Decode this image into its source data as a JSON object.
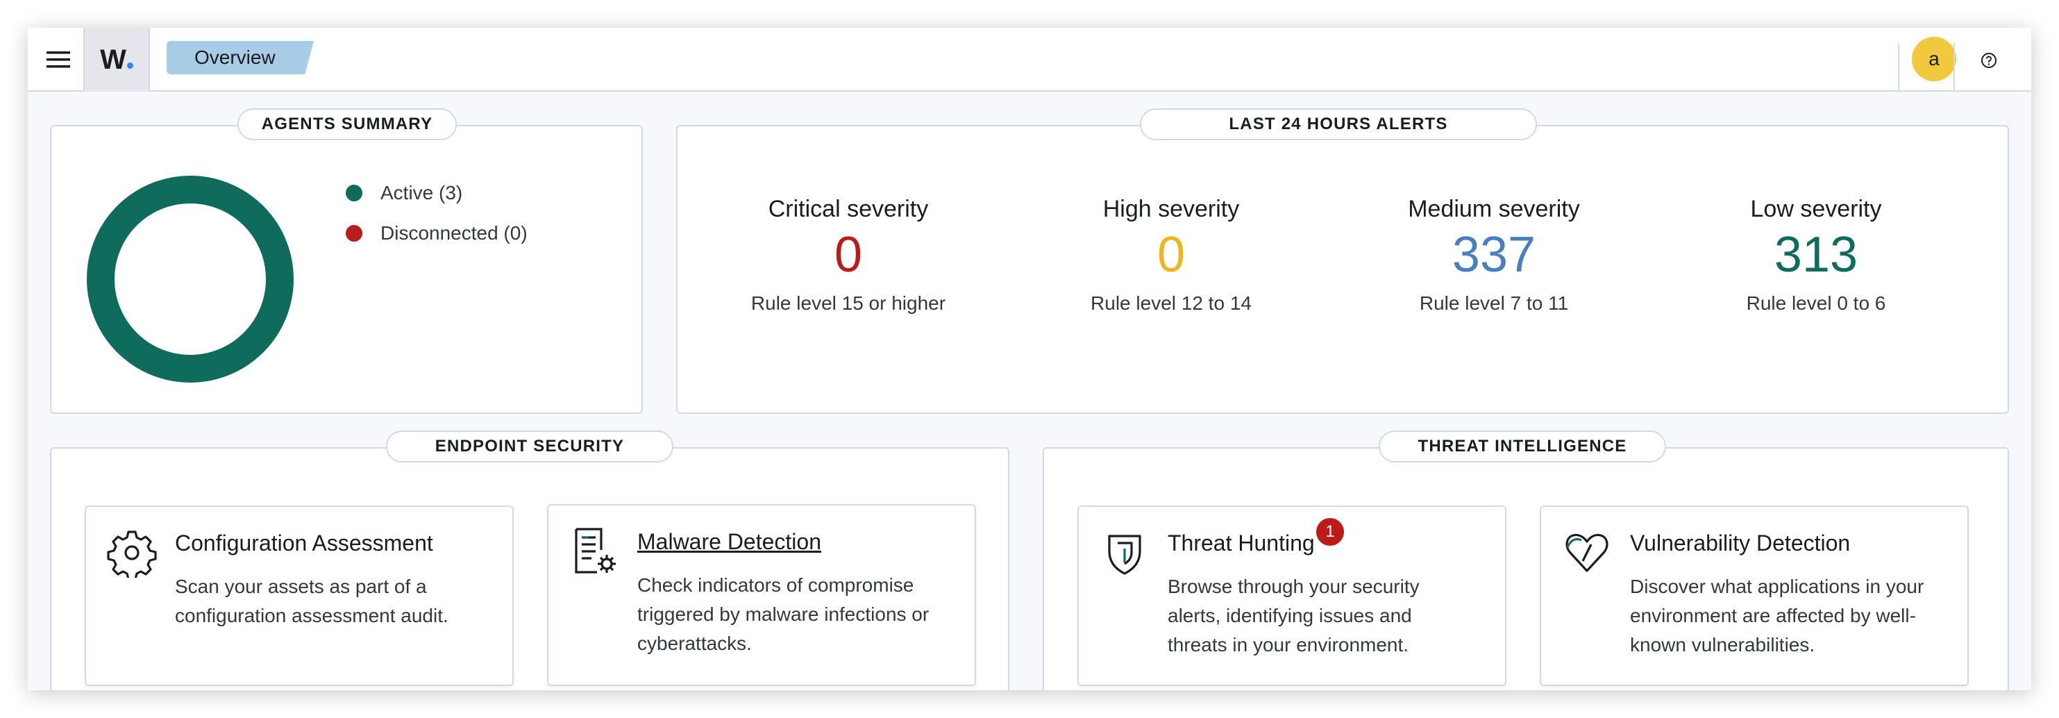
{
  "header": {
    "logo_text": "W.",
    "breadcrumb": "Overview",
    "avatar_letter": "a",
    "help_icon": "question-circle-icon",
    "menu_icon": "hamburger-icon"
  },
  "agents_summary": {
    "title": "AGENTS SUMMARY",
    "chart_data": {
      "type": "pie",
      "categories": [
        "Active (3)",
        "Disconnected (0)"
      ],
      "values": [
        3,
        0
      ],
      "colors": [
        "#0f6b5c",
        "#b91c1c"
      ]
    },
    "legend": [
      {
        "label": "Active (3)",
        "color": "#0f6b5c"
      },
      {
        "label": "Disconnected (0)",
        "color": "#b91c1c"
      }
    ]
  },
  "alerts": {
    "title": "LAST 24 HOURS ALERTS",
    "items": [
      {
        "title": "Critical severity",
        "value": "0",
        "sub": "Rule level 15 or higher",
        "color": "#b91c1c"
      },
      {
        "title": "High severity",
        "value": "0",
        "sub": "Rule level 12 to 14",
        "color": "#f0b51c"
      },
      {
        "title": "Medium severity",
        "value": "337",
        "sub": "Rule level 7 to 11",
        "color": "#4a7fbf"
      },
      {
        "title": "Low severity",
        "value": "313",
        "sub": "Rule level 0 to 6",
        "color": "#0f6b5c"
      }
    ]
  },
  "endpoint_security": {
    "title": "ENDPOINT SECURITY",
    "cards": [
      {
        "title": "Configuration Assessment",
        "desc_lines": [
          "Scan your assets as part of a",
          "configuration assessment audit."
        ],
        "icon": "gear-icon"
      },
      {
        "title": "Malware Detection",
        "desc_lines": [
          "Check indicators of compromise",
          "triggered by malware infections or",
          "cyberattacks."
        ],
        "icon": "document-gear-icon"
      }
    ]
  },
  "threat_intelligence": {
    "title": "THREAT INTELLIGENCE",
    "cards": [
      {
        "title": "Threat Hunting",
        "badge": "1",
        "desc_lines": [
          "Browse through your security",
          "alerts, identifying issues and",
          "threats in your environment."
        ],
        "icon": "shield-icon"
      },
      {
        "title": "Vulnerability Detection",
        "desc_lines": [
          "Discover what applications in your",
          "environment are affected by well-",
          "known vulnerabilities."
        ],
        "icon": "heart-pulse-icon"
      }
    ]
  }
}
